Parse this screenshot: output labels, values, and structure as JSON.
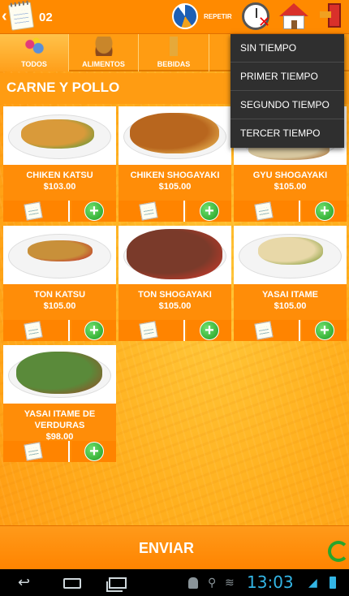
{
  "header": {
    "table_number": "02",
    "repeat_label": "REPETIR",
    "icons": [
      "back-chevron-icon",
      "notepad-icon",
      "repeat-icon",
      "clock-cancel-icon",
      "home-icon",
      "exit-door-icon"
    ]
  },
  "tabs": [
    {
      "label": "TODOS",
      "icon": "todos-icon",
      "active": true
    },
    {
      "label": "ALIMENTOS",
      "icon": "burger-icon",
      "active": false
    },
    {
      "label": "BEBIDAS",
      "icon": "drinks-icon",
      "active": false
    }
  ],
  "time_menu": {
    "items": [
      "SIN TIEMPO",
      "PRIMER TIEMPO",
      "SEGUNDO TIEMPO",
      "TERCER TIEMPO"
    ]
  },
  "category": {
    "title": "CARNE Y POLLO"
  },
  "products": [
    {
      "name": "CHIKEN KATSU",
      "price": "$103.00",
      "colors": [
        "#d99a3a",
        "#6c9a3a"
      ]
    },
    {
      "name": "CHIKEN SHOGAYAKI",
      "price": "$105.00",
      "colors": [
        "#b8661e",
        "#e6b050"
      ]
    },
    {
      "name": "GYU SHOGAYAKI",
      "price": "$105.00",
      "colors": [
        "#d8c8a0",
        "#b07a40"
      ]
    },
    {
      "name": "TON KATSU",
      "price": "$105.00",
      "colors": [
        "#c8903a",
        "#c0392b"
      ]
    },
    {
      "name": "TON SHOGAYAKI",
      "price": "$105.00",
      "colors": [
        "#7a3a2a",
        "#c0392b"
      ]
    },
    {
      "name": "YASAI ITAME",
      "price": "$105.00",
      "colors": [
        "#e8d8a8",
        "#8aa040"
      ]
    },
    {
      "name": "YASAI ITAME DE VERDURAS",
      "price": "$98.00",
      "colors": [
        "#5a8a3a",
        "#8a5a2a"
      ]
    }
  ],
  "footer": {
    "send_label": "ENVIAR"
  },
  "status_bar": {
    "time": "13:03"
  },
  "colors": {
    "accent": "#ff8a00",
    "menu_bg": "#2f2f2f",
    "add_green": "#1f9d1f",
    "clock_blue": "#33b5e5"
  }
}
